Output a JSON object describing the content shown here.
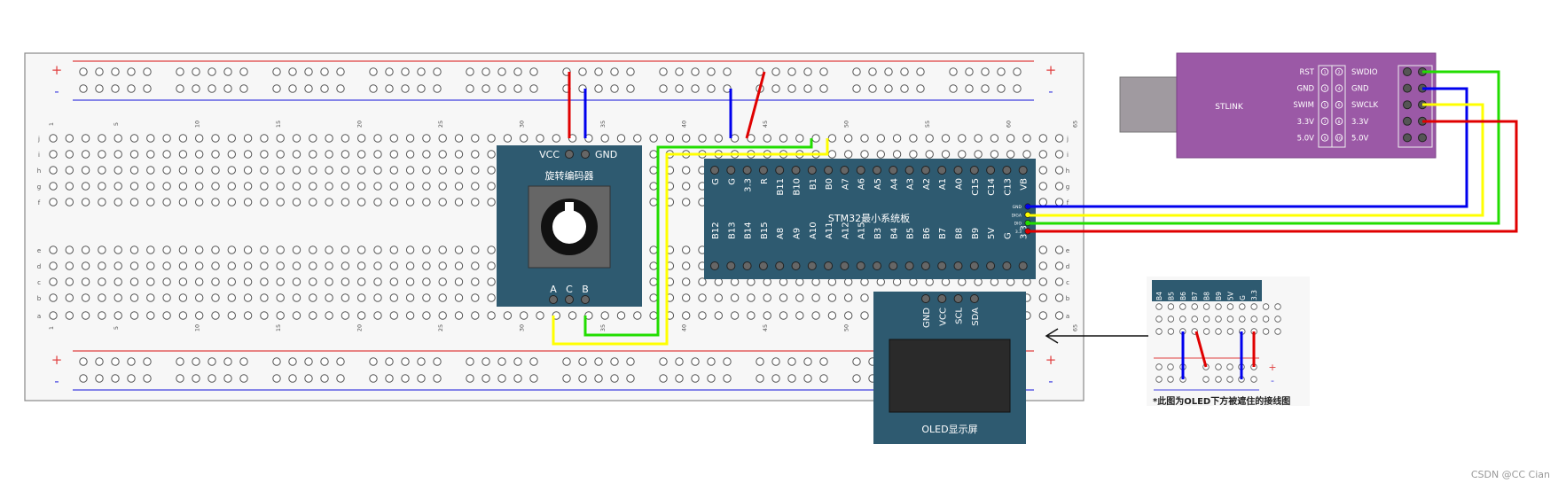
{
  "breadboard": {
    "rail_plus": "+",
    "rail_minus": "-",
    "column_numbers": [
      "1",
      "5",
      "10",
      "15",
      "20",
      "25",
      "30",
      "35",
      "40",
      "45",
      "50",
      "55",
      "60",
      "65"
    ],
    "row_letters_top": [
      "j",
      "i",
      "h",
      "g",
      "f"
    ],
    "row_letters_bottom": [
      "e",
      "d",
      "c",
      "b",
      "a"
    ]
  },
  "encoder": {
    "title": "旋转编码器",
    "pin_vcc": "VCC",
    "pin_gnd": "GND",
    "pin_a": "A",
    "pin_c": "C",
    "pin_b": "B"
  },
  "stm32": {
    "title": "STM32最小系统板",
    "top_pins": [
      "G",
      "G",
      "3.3",
      "R",
      "B11",
      "B10",
      "B1",
      "B0",
      "A7",
      "A6",
      "A5",
      "A4",
      "A3",
      "A2",
      "A1",
      "A0",
      "C15",
      "C14",
      "C13",
      "VB"
    ],
    "bottom_pins": [
      "B12",
      "B13",
      "B14",
      "B15",
      "A8",
      "A9",
      "A10",
      "A11",
      "A12",
      "A15",
      "B3",
      "B4",
      "B5",
      "B6",
      "B7",
      "B8",
      "B9",
      "5V",
      "G",
      "3.3"
    ],
    "swd_pins": [
      "GND",
      "DIGA",
      "DIO",
      "3.3"
    ]
  },
  "oled": {
    "title": "OLED显示屏",
    "pins": [
      "GND",
      "VCC",
      "SCL",
      "SDA"
    ]
  },
  "stlink": {
    "title": "STLINK",
    "left_labels": [
      "RST",
      "GND",
      "SWIM",
      "3.3V",
      "5.0V"
    ],
    "right_labels": [
      "SWDIO",
      "GND",
      "SWCLK",
      "3.3V",
      "5.0V"
    ],
    "left_numbers": [
      "1",
      "3",
      "5",
      "7",
      "9"
    ],
    "right_numbers": [
      "2",
      "4",
      "6",
      "8",
      "10"
    ]
  },
  "inset": {
    "pins": [
      "B4",
      "B5",
      "B6",
      "B7",
      "B8",
      "B9",
      "5V",
      "G",
      "3.3"
    ],
    "caption": "*此图为OLED下方被遮住的接线图",
    "rail_plus": "+",
    "rail_minus": "-"
  },
  "watermark": "CSDN @CC Cian",
  "colors": {
    "wire_red": "#e00000",
    "wire_blue": "#0000ee",
    "wire_green": "#22dd00",
    "wire_yellow": "#ffff00",
    "module_board": "#2e5a70",
    "stlink_body": "#9b59a6",
    "breadboard_bg": "#f7f7f7"
  }
}
